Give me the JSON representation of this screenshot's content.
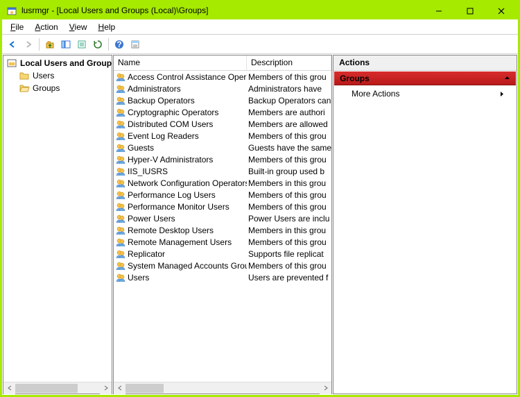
{
  "window": {
    "title": "lusrmgr - [Local Users and Groups (Local)\\Groups]"
  },
  "menus": {
    "file": "File",
    "action": "Action",
    "view": "View",
    "help": "Help"
  },
  "tree": {
    "root": "Local Users and Groups (Lo",
    "users": "Users",
    "groups": "Groups"
  },
  "columns": {
    "name": "Name",
    "description": "Description"
  },
  "groups": [
    {
      "name": "Access Control Assistance Operators",
      "desc": "Members of this grou"
    },
    {
      "name": "Administrators",
      "desc": "Administrators have"
    },
    {
      "name": "Backup Operators",
      "desc": "Backup Operators can"
    },
    {
      "name": "Cryptographic Operators",
      "desc": "Members are authori"
    },
    {
      "name": "Distributed COM Users",
      "desc": "Members are allowed"
    },
    {
      "name": "Event Log Readers",
      "desc": "Members of this grou"
    },
    {
      "name": "Guests",
      "desc": "Guests have the same"
    },
    {
      "name": "Hyper-V Administrators",
      "desc": "Members of this grou"
    },
    {
      "name": "IIS_IUSRS",
      "desc": "Built-in group used b"
    },
    {
      "name": "Network Configuration Operators",
      "desc": "Members in this grou"
    },
    {
      "name": "Performance Log Users",
      "desc": "Members of this grou"
    },
    {
      "name": "Performance Monitor Users",
      "desc": "Members of this grou"
    },
    {
      "name": "Power Users",
      "desc": "Power Users are inclu"
    },
    {
      "name": "Remote Desktop Users",
      "desc": "Members in this grou"
    },
    {
      "name": "Remote Management Users",
      "desc": "Members of this grou"
    },
    {
      "name": "Replicator",
      "desc": "Supports file replicat"
    },
    {
      "name": "System Managed Accounts Group",
      "desc": "Members of this grou"
    },
    {
      "name": "Users",
      "desc": "Users are prevented f"
    }
  ],
  "actions": {
    "header": "Actions",
    "section": "Groups",
    "more": "More Actions"
  }
}
